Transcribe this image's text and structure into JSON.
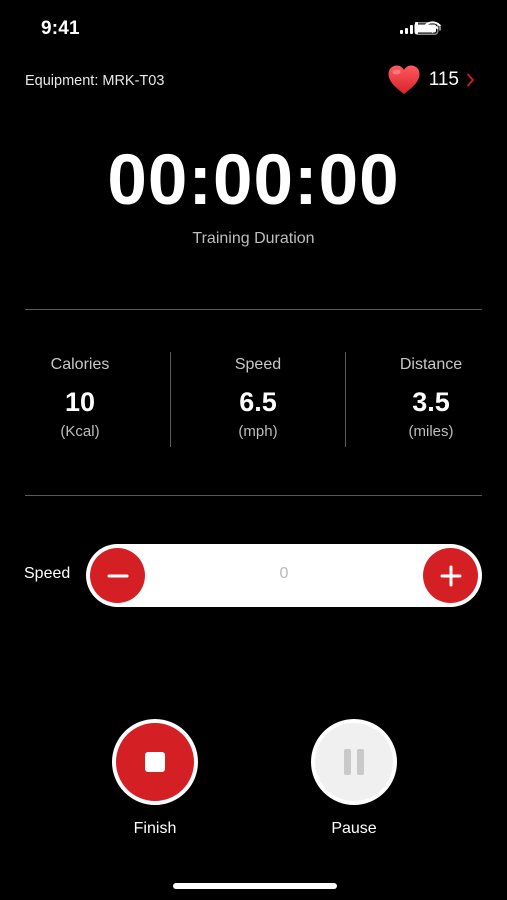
{
  "status_bar": {
    "time": "9:41",
    "icons": [
      "signal-icon",
      "wifi-icon",
      "battery-icon"
    ]
  },
  "header": {
    "equipment": "Equipment: MRK-T03",
    "heart_rate": "115",
    "heart_icon": "heart-icon",
    "chevron_icon": "chevron-right-icon"
  },
  "timer": {
    "value": "00:00:00",
    "caption": "Training Duration"
  },
  "stats": [
    {
      "label": "Calories",
      "value": "10",
      "unit": "(Kcal)"
    },
    {
      "label": "Speed",
      "value": "6.5",
      "unit": "(mph)"
    },
    {
      "label": "Distance",
      "value": "3.5",
      "unit": "(miles)"
    }
  ],
  "speed_control": {
    "label": "Speed",
    "value": "0",
    "decrease_icon": "minus-icon",
    "increase_icon": "plus-icon"
  },
  "actions": {
    "finish_label": "Finish",
    "finish_icon": "stop-icon",
    "pause_label": "Pause",
    "pause_icon": "pause-icon"
  },
  "colors": {
    "background": "#000000",
    "accent_red": "#d42025",
    "heart": "#e8333a",
    "divider": "#5a5a5a",
    "pause_button": "#f0f0f0",
    "pause_glyph": "#c9c9c9"
  }
}
